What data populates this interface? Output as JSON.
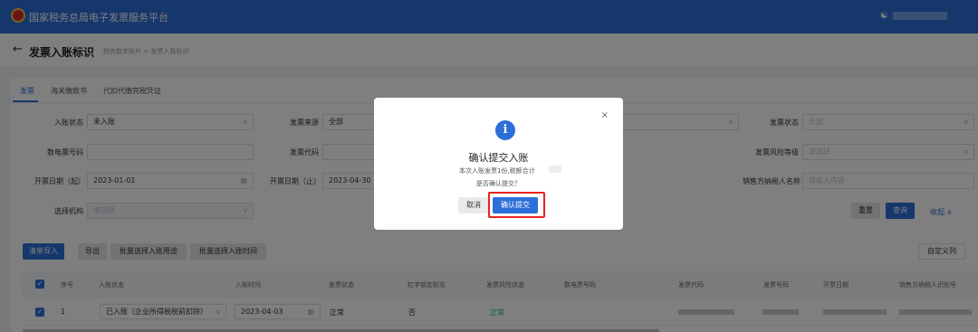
{
  "app": {
    "title": "国家税务总局电子发票服务平台",
    "user_icon": "user-icon"
  },
  "header": {
    "back_icon": "←",
    "title": "发票入账标识",
    "breadcrumb": "税务数字账户 > 发票入账标识"
  },
  "tabs": [
    "发票",
    "海关缴款书",
    "代扣代缴完税凭证"
  ],
  "filters": {
    "entry_status_label": "入账状态",
    "entry_status_value": "未入账",
    "invoice_source_label": "发票来源",
    "invoice_source_value": "全部",
    "invoice_status_label": "发票状态",
    "invoice_status_value": "全部",
    "digital_no_label": "数电票号码",
    "invoice_code_label": "发票代码",
    "risk_level_label": "发票风险等级",
    "risk_level_placeholder": "请选择",
    "date_start_label": "开票日期（起）",
    "date_start_value": "2023-01-01",
    "date_end_label": "开票日期（止）",
    "date_end_value": "2023-04-30",
    "seller_label": "销售方纳税人名称",
    "seller_placeholder": "请输入内容",
    "org_label": "选择机构",
    "org_placeholder": "请选择",
    "reset_label": "重置",
    "query_label": "查询",
    "collapse_label": "收起 ∧"
  },
  "toolbar": {
    "import_label": "清单导入",
    "export_label": "导出",
    "batch_purpose_label": "批量选择入账用途",
    "batch_time_label": "批量选择入账时间",
    "custom_cols_label": "自定义列"
  },
  "table": {
    "headers": [
      "序号",
      "入账状态",
      "入账时间",
      "发票状态",
      "红字锁定标志",
      "发票风险状态",
      "数电票号码",
      "发票代码",
      "发票号码",
      "开票日期",
      "销售方纳税人识别号"
    ],
    "row": {
      "index": "1",
      "entry_status": "已入账（企业所得税税前扣除）",
      "entry_time": "2023-04-03",
      "invoice_status": "正常",
      "red_lock": "否",
      "risk_status": "正常"
    }
  },
  "modal": {
    "icon": "i",
    "title": "确认提交入账",
    "text1": "本次入账发票1份,税额合计",
    "text2": "是否确认提交？",
    "cancel_label": "取消",
    "confirm_label": "确认提交",
    "close_icon": "×"
  },
  "colors": {
    "brand": "#2c6fd9",
    "highlight": "#e8231c",
    "success": "#19be6b"
  }
}
